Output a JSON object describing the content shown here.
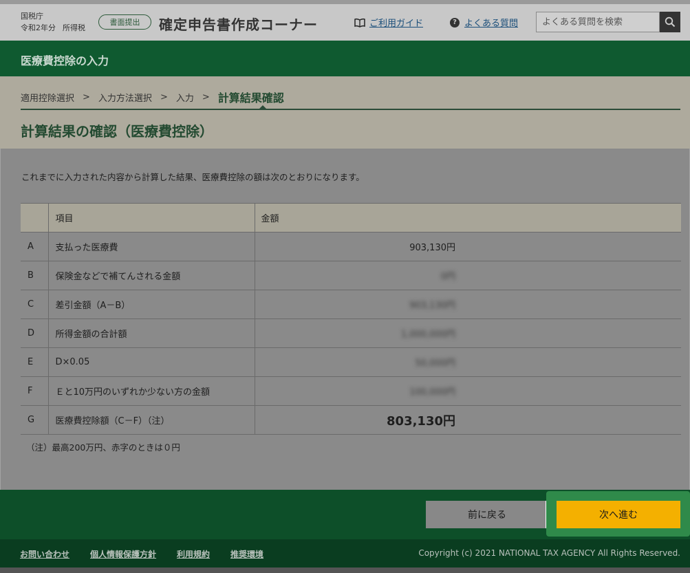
{
  "header": {
    "agency": "国税庁",
    "year": "令和2年分",
    "tax": "所得税",
    "badge": "書面提出",
    "app_title": "確定申告書作成コーナー",
    "guide_link": "ご利用ガイド",
    "faq_link": "よくある質問",
    "search_placeholder": "よくある質問を検索",
    "icons": {
      "guide": "book-icon",
      "faq": "question-icon",
      "search": "search-icon"
    }
  },
  "section": {
    "title": "医療費控除の入力"
  },
  "steps": [
    {
      "label": "適用控除選択"
    },
    {
      "label": "入力方法選択"
    },
    {
      "label": "入力"
    },
    {
      "label": "計算結果確認",
      "current": true
    }
  ],
  "page_title": "計算結果の確認（医療費控除）",
  "intro": "これまでに入力された内容から計算した結果、医療費控除の額は次のとおりになります。",
  "table": {
    "headers": {
      "letter": "",
      "item": "項目",
      "amount": "金額"
    },
    "rows": [
      {
        "letter": "A",
        "item": "支払った医療費",
        "amount": "903,130円",
        "blurred": false
      },
      {
        "letter": "B",
        "item": "保険金などで補てんされる金額",
        "amount": "0円",
        "blurred": true
      },
      {
        "letter": "C",
        "item": "差引金額（A－B）",
        "amount": "903,130円",
        "blurred": true
      },
      {
        "letter": "D",
        "item": "所得金額の合計額",
        "amount": "1,000,000円",
        "blurred": true
      },
      {
        "letter": "E",
        "item": "D×0.05",
        "amount": "50,000円",
        "blurred": true
      },
      {
        "letter": "F",
        "item": "Ｅと10万円のいずれか少ない方の金額",
        "amount": "100,000円",
        "blurred": true
      },
      {
        "letter": "G",
        "item": "医療費控除額（C－F）（注）",
        "amount": "803,130円",
        "blurred": false,
        "total": true
      }
    ]
  },
  "note": "（注）最高200万円、赤字のときは０円",
  "actions": {
    "back": "前に戻る",
    "next": "次へ進む"
  },
  "footer": {
    "links": [
      "お問い合わせ",
      "個人情報保護方針",
      "利用規約",
      "推奨環境"
    ],
    "copyright": "Copyright (c) 2021 NATIONAL TAX AGENCY All Rights Reserved."
  },
  "colors": {
    "brand_green": "#0f5a30",
    "next_button": "#f4b000"
  }
}
